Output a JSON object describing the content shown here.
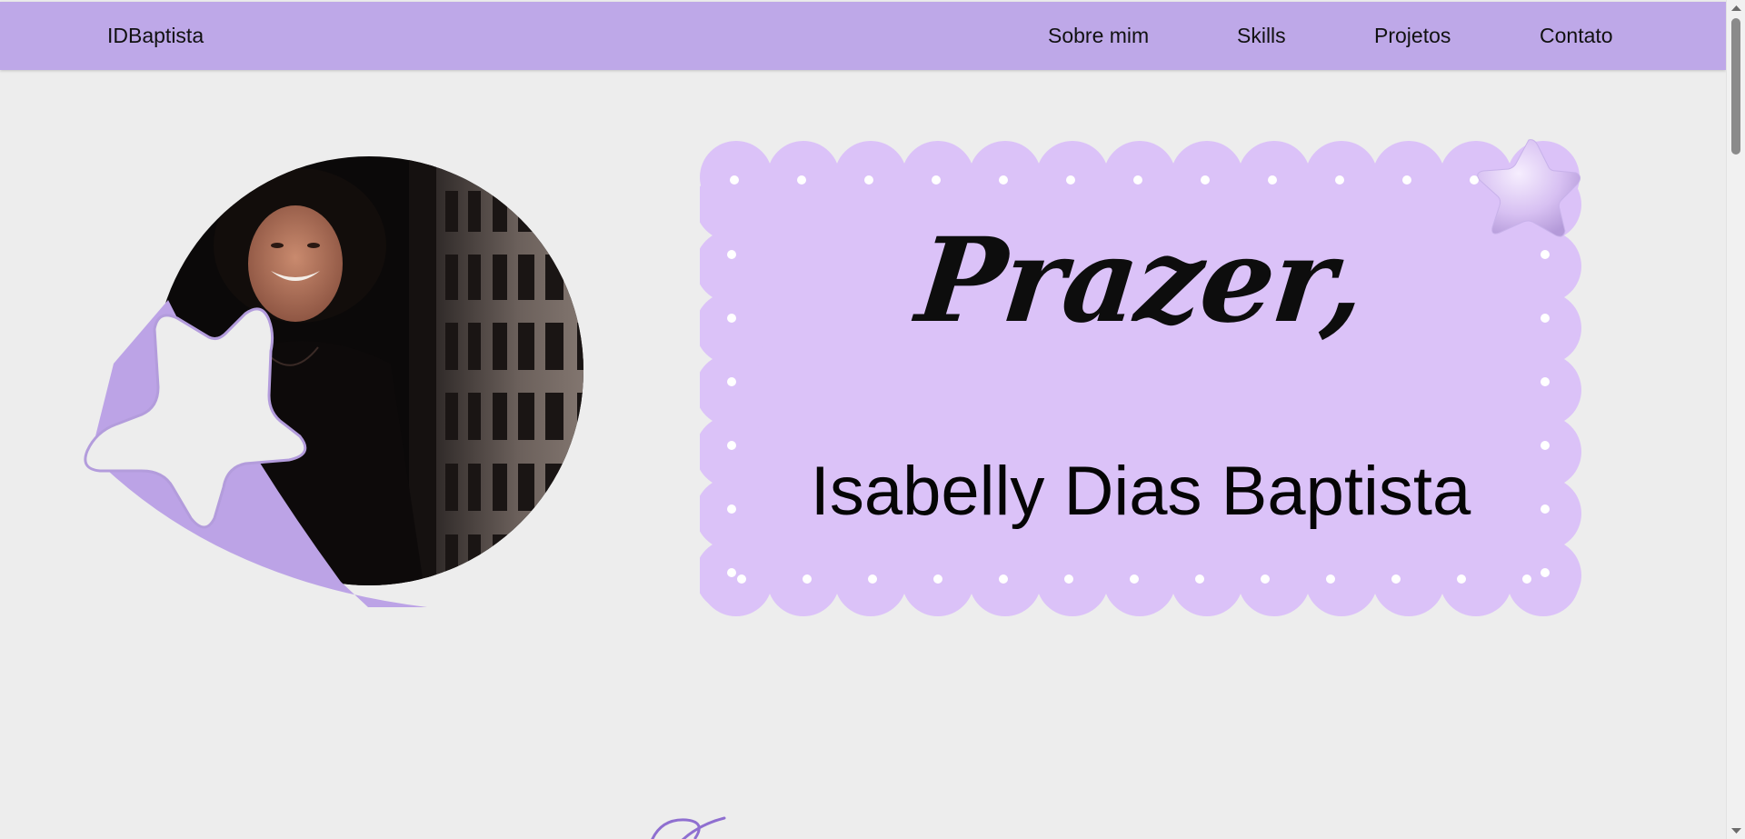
{
  "nav": {
    "brand": "IDBaptista",
    "links": [
      "Sobre mim",
      "Skills",
      "Projetos",
      "Contato"
    ]
  },
  "hero": {
    "greeting": "Prazer,",
    "name": "Isabelly Dias Baptista"
  },
  "colors": {
    "nav_bg": "#bea8e8",
    "page_bg": "#ededed",
    "card_bg": "#dbc2f8",
    "accent": "#bca3e6",
    "text": "#0d0d0d"
  },
  "icons": [
    "star-outline-icon",
    "star-3d-icon",
    "squiggle-doodle-icon"
  ]
}
